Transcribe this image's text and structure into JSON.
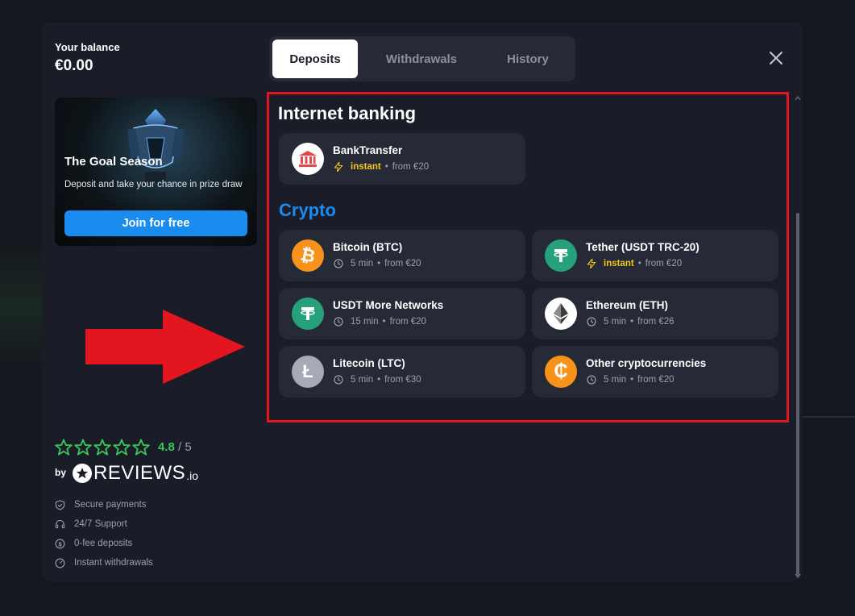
{
  "balance": {
    "label": "Your balance",
    "value": "€0.00"
  },
  "promo": {
    "title": "The Goal Season",
    "text": "Deposit and take your chance in prize draw",
    "button": "Join for free"
  },
  "tabs": [
    {
      "label": "Deposits",
      "active": true
    },
    {
      "label": "Withdrawals",
      "active": false
    },
    {
      "label": "History",
      "active": false
    }
  ],
  "sections": {
    "banking_title": "Internet banking",
    "crypto_title": "Crypto"
  },
  "methods": [
    {
      "name": "BankTransfer",
      "speed": "instant",
      "instant": true,
      "min": "from €20",
      "icon": "bank-icon",
      "color": "#ffffff"
    },
    {
      "name": "Bitcoin (BTC)",
      "speed": "5 min",
      "instant": false,
      "min": "from €20",
      "icon": "bitcoin-icon",
      "color": "#f7931a"
    },
    {
      "name": "Tether (USDT TRC-20)",
      "speed": "instant",
      "instant": true,
      "min": "from €20",
      "icon": "tether-icon",
      "color": "#26a17b"
    },
    {
      "name": "USDT More Networks",
      "speed": "15 min",
      "instant": false,
      "min": "from €20",
      "icon": "tether-icon",
      "color": "#26a17b"
    },
    {
      "name": "Ethereum (ETH)",
      "speed": "5 min",
      "instant": false,
      "min": "from €26",
      "icon": "ethereum-icon",
      "color": "#ffffff"
    },
    {
      "name": "Litecoin (LTC)",
      "speed": "5 min",
      "instant": false,
      "min": "from €30",
      "icon": "litecoin-icon",
      "color": "#a6a9b6"
    },
    {
      "name": "Other cryptocurrencies",
      "speed": "5 min",
      "instant": false,
      "min": "from €20",
      "icon": "coin-icon",
      "color": "#f7931a"
    }
  ],
  "rating": {
    "value": "4.8",
    "out_of": "/ 5",
    "stars": 5
  },
  "reviews": {
    "by": "by",
    "brand": "REVIEWS",
    "suffix": ".io"
  },
  "features": [
    {
      "label": "Secure payments",
      "icon": "shield-icon"
    },
    {
      "label": "24/7 Support",
      "icon": "headset-icon"
    },
    {
      "label": "0-fee deposits",
      "icon": "dollar-icon"
    },
    {
      "label": "Instant withdrawals",
      "icon": "speedometer-icon"
    }
  ],
  "colors": {
    "accent": "#1a8cf0",
    "instant": "#f5c518",
    "highlight": "#e3161f",
    "rating": "#38c95a",
    "crypto_title": "#1a8cf0"
  }
}
